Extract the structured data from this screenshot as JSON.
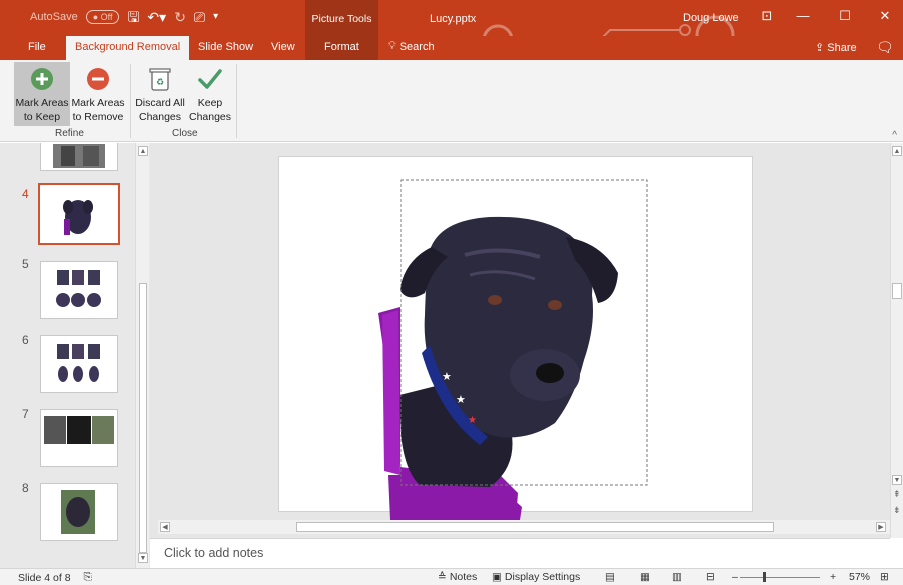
{
  "titlebar": {
    "autosave_label": "AutoSave",
    "autosave_state": "Off",
    "tools_label": "Picture Tools",
    "doc_title": "Lucy.pptx",
    "user": "Doug Lowe"
  },
  "tabs": {
    "file": "File",
    "background_removal": "Background Removal",
    "slide_show": "Slide Show",
    "view": "View",
    "format": "Format",
    "search": "Search",
    "share": "Share"
  },
  "ribbon": {
    "mark_keep": [
      "Mark Areas",
      "to Keep"
    ],
    "mark_remove": [
      "Mark Areas",
      "to Remove"
    ],
    "discard": [
      "Discard All",
      "Changes"
    ],
    "keep": [
      "Keep",
      "Changes"
    ],
    "group_refine": "Refine",
    "group_close": "Close"
  },
  "thumbnails": [
    {
      "num": "4"
    },
    {
      "num": "5"
    },
    {
      "num": "6"
    },
    {
      "num": "7"
    },
    {
      "num": "8"
    }
  ],
  "notes": {
    "placeholder": "Click to add notes"
  },
  "status": {
    "slide_info": "Slide 4 of 8",
    "notes": "Notes",
    "display_settings": "Display Settings",
    "zoom": "57%",
    "zoom_plus": "+",
    "zoom_minus": "–"
  },
  "colors": {
    "accent": "#c43e1c",
    "removal_magenta": "#8c1aa8"
  }
}
